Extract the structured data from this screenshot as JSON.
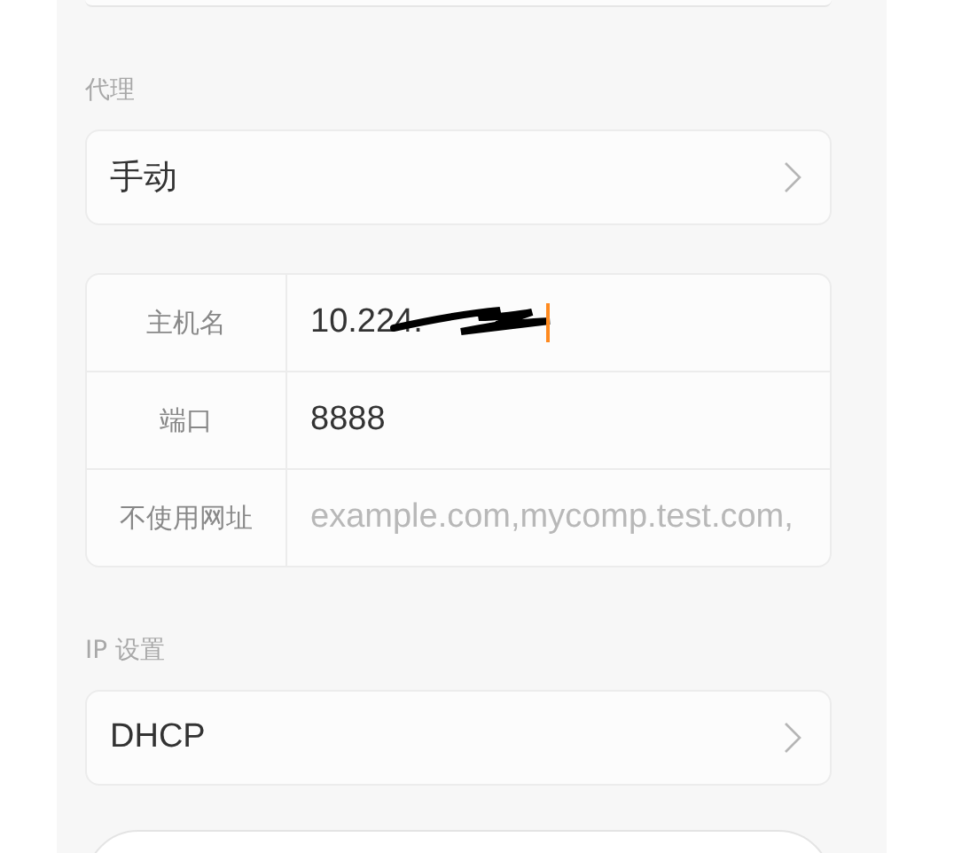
{
  "proxy": {
    "heading": "代理",
    "value": "手动"
  },
  "proxy_fields": [
    {
      "label": "主机名",
      "value": "10.224.",
      "redacted": true,
      "focused": true
    },
    {
      "label": "端口",
      "value": "8888",
      "redacted": false,
      "focused": false
    },
    {
      "label": "不使用网址",
      "placeholder": "example.com,mycomp.test.com,",
      "redacted": false,
      "focused": false
    }
  ],
  "ip_settings": {
    "heading": "IP 设置",
    "value": "DHCP"
  }
}
